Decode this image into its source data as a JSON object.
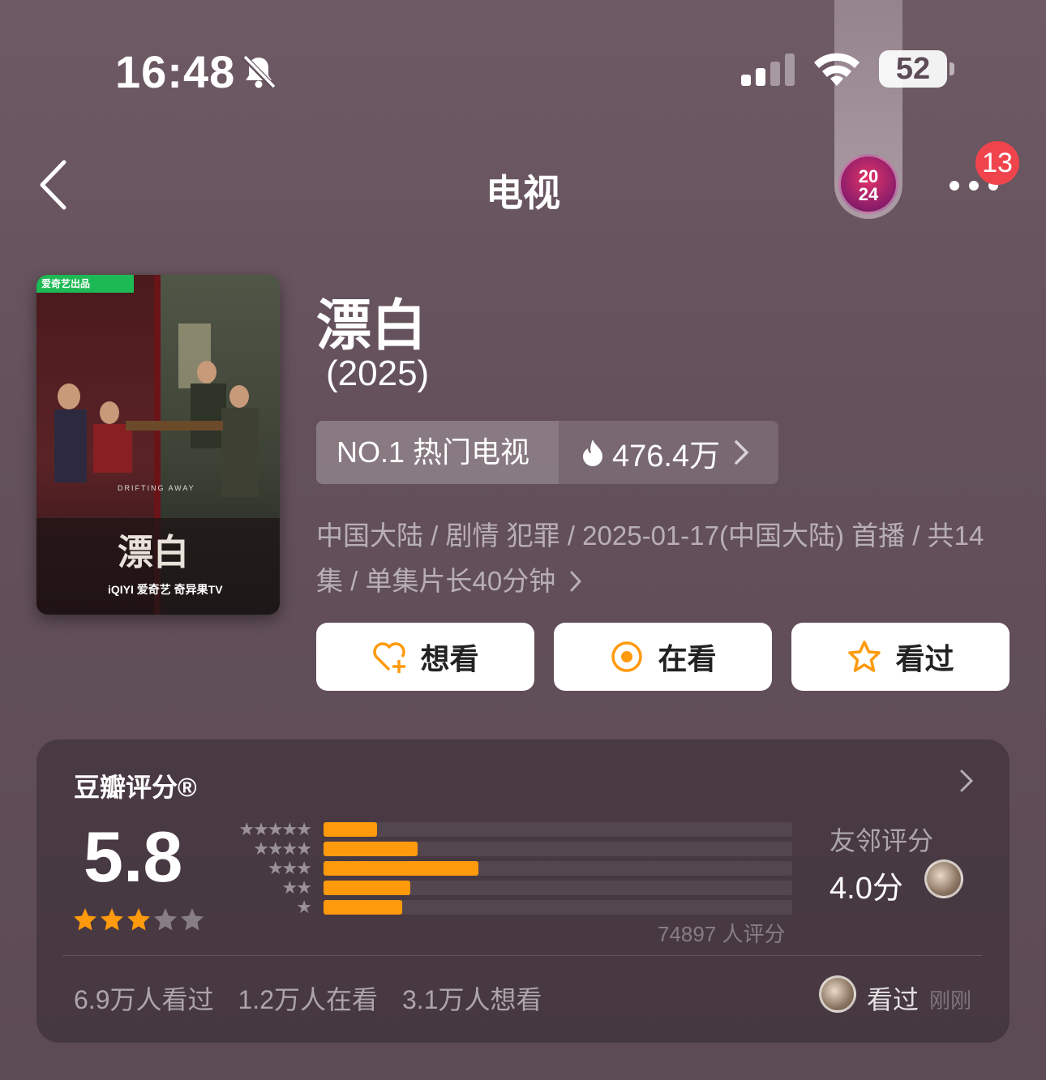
{
  "status_bar": {
    "time": "16:48",
    "battery": "52"
  },
  "nav": {
    "title": "电视",
    "badge_line1": "20",
    "badge_line2": "24",
    "notification_count": "13"
  },
  "movie": {
    "title": "漂白",
    "year": "(2025)",
    "rank_label": "NO.1 热门电视",
    "heat": "476.4万",
    "meta_line1": "中国大陆 / 剧情 犯罪 / 2025-01-17(中国大陆) 首播 / 共14",
    "meta_line2": "集 / 单集片长40分钟"
  },
  "poster": {
    "badge_text": "爱奇艺出品",
    "title": "漂白",
    "subtitle": "DRIFTING AWAY",
    "platform": "iQIYI 爱奇艺  奇异果TV"
  },
  "actions": {
    "want": "想看",
    "watching": "在看",
    "watched": "看过"
  },
  "rating": {
    "title": "豆瓣评分®",
    "score": "5.8",
    "score_stars": 3,
    "distribution": [
      {
        "stars": "★★★★★",
        "fraction": 0.115
      },
      {
        "stars": "★★★★",
        "fraction": 0.2
      },
      {
        "stars": "★★★",
        "fraction": 0.33
      },
      {
        "stars": "★★",
        "fraction": 0.185
      },
      {
        "stars": "★",
        "fraction": 0.168
      }
    ],
    "raters": "74897 人评分",
    "friend_title": "友邻评分",
    "friend_score": "4.0分",
    "counts": [
      "6.9万人看过",
      "1.2万人在看",
      "3.1万人想看"
    ],
    "my_status": "看过",
    "my_time": "刚刚"
  },
  "colors": {
    "accent": "#ff9a0c",
    "background": "#63505a",
    "notification": "#f0444d"
  }
}
